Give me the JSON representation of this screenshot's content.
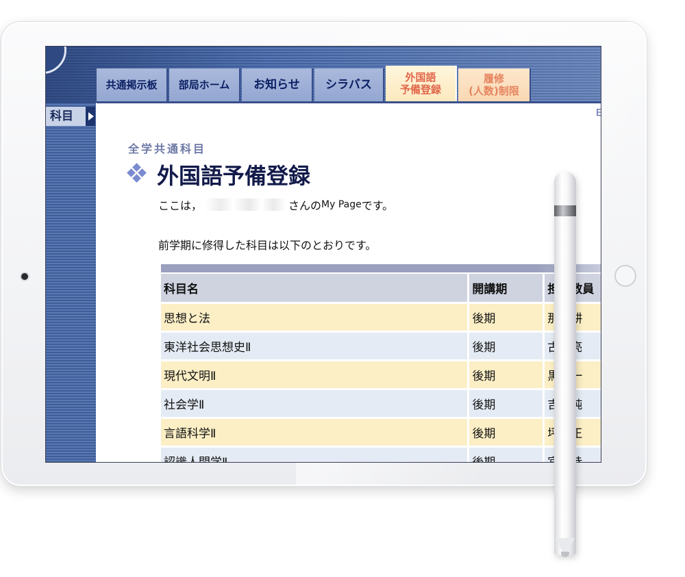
{
  "header": {
    "tabs": [
      {
        "label": "共通掲示板"
      },
      {
        "label": "部局ホーム"
      },
      {
        "label": "お知らせ"
      },
      {
        "label": "シラバス"
      },
      {
        "line1": "外国語",
        "line2": "予備登録"
      },
      {
        "line1": "履修",
        "line2": "(人数)制限"
      }
    ],
    "corner_char": "E"
  },
  "sidebar": {
    "label": "科目"
  },
  "main": {
    "category": "全学共通科目",
    "title": "外国語予備登録",
    "intro_before": "ここは，",
    "intro_after": "さんの",
    "intro_mypage": "My Page",
    "intro_end": "です。",
    "prev_text": "前学期に修得した科目は以下のとおりです。"
  },
  "table": {
    "headers": [
      "科目名",
      "開講期",
      "担当教員"
    ],
    "rows": [
      {
        "name": "思想と法",
        "term": "後期",
        "teacher": "那　耕"
      },
      {
        "name": "東洋社会思想史Ⅱ",
        "term": "後期",
        "teacher": "古　亮"
      },
      {
        "name": "現代文明Ⅱ",
        "term": "後期",
        "teacher": "黒　一"
      },
      {
        "name": "社会学Ⅱ",
        "term": "後期",
        "teacher": "吉　純"
      },
      {
        "name": "言語科学Ⅱ",
        "term": "後期",
        "teacher": "坪　正"
      },
      {
        "name": "認識人間学Ⅱ",
        "term": "後期",
        "teacher": "宮　恭"
      }
    ]
  }
}
